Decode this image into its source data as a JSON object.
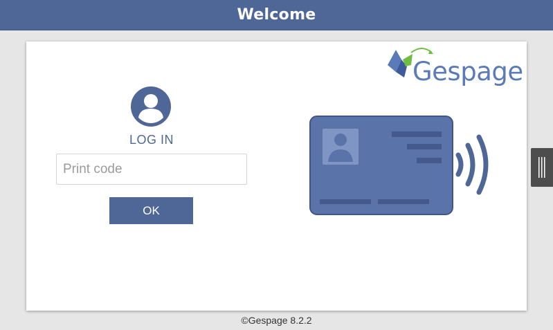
{
  "header": {
    "title": "Welcome"
  },
  "brand": {
    "logo_text": "Gespage"
  },
  "login": {
    "label": "LOG IN",
    "input_placeholder": "Print code",
    "ok_label": "OK"
  },
  "footer": {
    "text": "©Gespage 8.2.2"
  },
  "colors": {
    "primary": "#4e6797",
    "card": "#5a73a8",
    "logo_blue": "#5b7bb8",
    "logo_green": "#6fbe44",
    "handle": "#4d4d4d",
    "background": "#e6e6e6"
  },
  "icons": [
    "user-circle-icon",
    "id-card-contactless-icon",
    "gespage-logo",
    "drag-handle-icon"
  ]
}
